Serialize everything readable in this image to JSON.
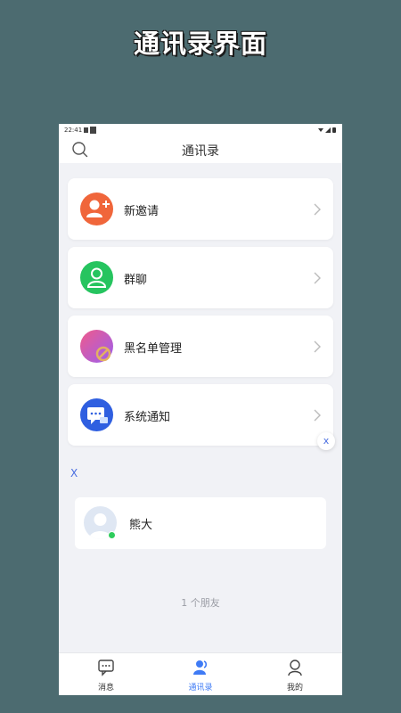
{
  "banner": {
    "title": "通讯录界面"
  },
  "status_bar": {
    "time": "22:41"
  },
  "header": {
    "title": "通讯录"
  },
  "menu": {
    "items": [
      {
        "label": "新邀请",
        "icon": "add-user-icon",
        "color": "#f0663b"
      },
      {
        "label": "群聊",
        "icon": "group-chat-icon",
        "color": "#26c45f"
      },
      {
        "label": "黑名单管理",
        "icon": "blacklist-icon",
        "color": "#b05fe0"
      },
      {
        "label": "系统通知",
        "icon": "system-notice-icon",
        "color": "#2f5fe0"
      }
    ]
  },
  "index_badge": "x",
  "section": {
    "letter": "X"
  },
  "friends": [
    {
      "name": "熊大",
      "online": true
    }
  ],
  "footer": {
    "count": "1 个朋友"
  },
  "tabs": [
    {
      "label": "消息",
      "icon": "message-icon",
      "active": false
    },
    {
      "label": "通讯录",
      "icon": "contacts-icon",
      "active": true
    },
    {
      "label": "我的",
      "icon": "profile-icon",
      "active": false
    }
  ],
  "colors": {
    "accent": "#3f7bf5",
    "background": "#4c6b70",
    "online": "#2ecc5c"
  }
}
